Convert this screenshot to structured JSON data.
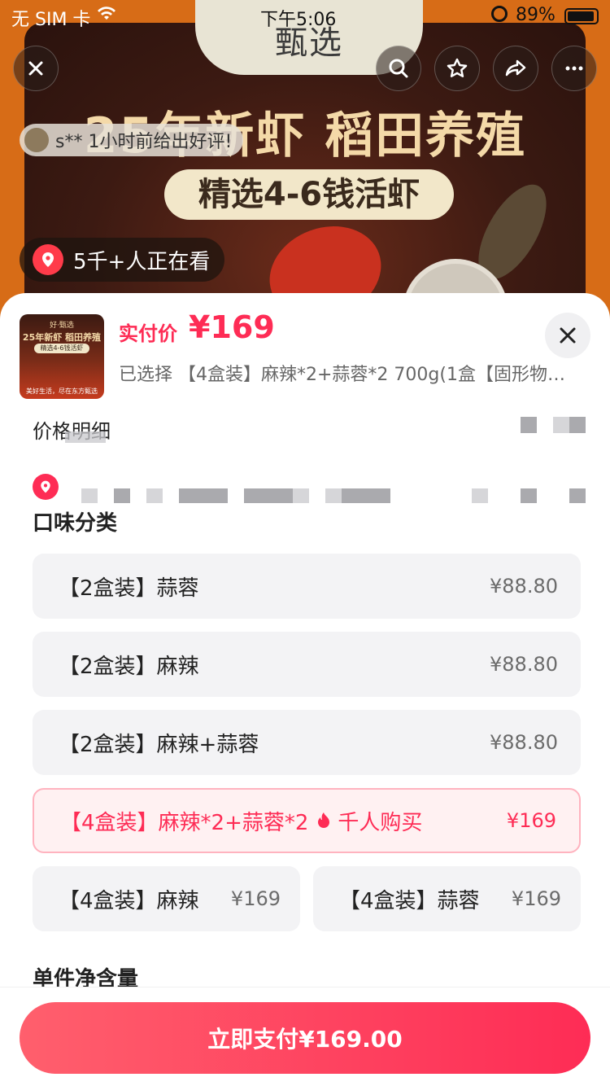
{
  "status_bar": {
    "carrier": "无 SIM 卡",
    "time": "下午5:06",
    "battery": "89%"
  },
  "hero": {
    "tab_text": "甄选",
    "title": "25年新虾 稻田养殖",
    "pill": "精选4-6钱活虾",
    "review_text": "s** 1小时前给出好评!",
    "watching_text": "5千+人正在看"
  },
  "thumbnail": {
    "line1": "好·甄选",
    "line2": "25年新虾 稻田养殖",
    "line3": "精选4-6钱活虾",
    "line4": "美好生活，尽在东方甄选"
  },
  "sheet": {
    "price_label": "实付价",
    "price_value": "¥169",
    "selected_text": "已选择 【4盒装】麻辣*2+蒜蓉*2 700g(1盒【固形物…",
    "price_detail_label": "价格明细",
    "section_flavor": "口味分类",
    "section_net": "单件净含量"
  },
  "options": [
    {
      "label": "【2盒装】蒜蓉",
      "price": "¥88.80"
    },
    {
      "label": "【2盒装】麻辣",
      "price": "¥88.80"
    },
    {
      "label": "【2盒装】麻辣+蒜蓉",
      "price": "¥88.80"
    },
    {
      "label": "【4盒装】麻辣*2+蒜蓉*2",
      "tag": "千人购买",
      "price": "¥169"
    },
    {
      "label": "【4盒装】麻辣",
      "price": "¥169"
    },
    {
      "label": "【4盒装】蒜蓉",
      "price": "¥169"
    }
  ],
  "pay_button": "立即支付¥169.00",
  "colors": {
    "accent": "#fe2c55",
    "hero_orange": "#d76c17",
    "option_bg": "#f3f3f5"
  }
}
